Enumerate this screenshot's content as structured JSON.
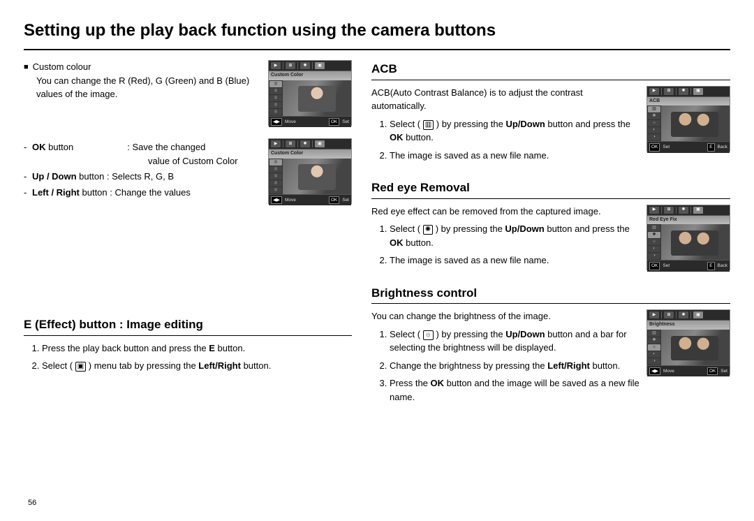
{
  "page": {
    "title": "Setting up the play back function using the camera buttons",
    "number": "56"
  },
  "custom_colour": {
    "heading": "Custom colour",
    "desc": "You can change the R (Red), G (Green) and B (Blue) values of the image.",
    "defs": {
      "ok": {
        "label": "OK",
        "suffix": " button",
        "value_line1": ": Save the changed",
        "value_line2": "value of Custom Color"
      },
      "updown": {
        "label": "Up / Down",
        "suffix": " button  : Selects R, G, B"
      },
      "leftright": {
        "label": "Left / Right",
        "suffix": " button : Change the values"
      }
    },
    "screenshot": {
      "label": "Custom Color",
      "bottom_left_btn": "◀▶",
      "bottom_left_text": "Move",
      "bottom_right_btn": "OK",
      "bottom_right_text": "Set"
    }
  },
  "effect": {
    "heading": "E (Effect) button : Image editing",
    "step1_a": "Press the play back button and press the ",
    "step1_bold": "E",
    "step1_b": " button.",
    "step2_a": "Select ( ",
    "step2_glyph": "▣",
    "step2_b": " ) menu tab by pressing the ",
    "step2_bold": "Left/Right",
    "step2_c": " button."
  },
  "acb": {
    "heading": "ACB",
    "desc": "ACB(Auto Contrast Balance) is to adjust the contrast automatically.",
    "step1_a": "Select ( ",
    "step1_glyph": "▥",
    "step1_b": " ) by pressing the ",
    "step1_bold1": "Up/Down",
    "step1_c": " button and press the ",
    "step1_bold2": "OK",
    "step1_d": " button.",
    "step2": "The image is saved as a new file name.",
    "screenshot": {
      "label": "ACB",
      "bottom_left_btn": "OK",
      "bottom_left_text": "Set",
      "bottom_right_btn": "E",
      "bottom_right_text": "Back"
    }
  },
  "redeye": {
    "heading": "Red eye Removal",
    "desc": "Red eye effect can be removed from the captured image.",
    "step1_a": "Select ( ",
    "step1_glyph": "✺",
    "step1_b": " ) by pressing the ",
    "step1_bold1": "Up/Down",
    "step1_c": " button and press the ",
    "step1_bold2": "OK",
    "step1_d": " button.",
    "step2": "The image is saved as a new file name.",
    "screenshot": {
      "label": "Red Eye Fix",
      "bottom_left_btn": "OK",
      "bottom_left_text": "Set",
      "bottom_right_btn": "E",
      "bottom_right_text": "Back"
    }
  },
  "brightness": {
    "heading": "Brightness control",
    "desc": "You can change the brightness of the image.",
    "step1_a": "Select ( ",
    "step1_b": " ) by pressing the ",
    "step1_bold1": "Up/Down",
    "step1_c": " button and a bar for selecting the brightness will be displayed.",
    "step2_a": "Change the brightness by pressing the ",
    "step2_bold": "Left/Right",
    "step2_b": "  button.",
    "step3_a": "Press the ",
    "step3_bold": "OK",
    "step3_b": " button and the image will be saved as a new file name.",
    "screenshot": {
      "label": "Brightness",
      "bottom_left_btn": "◀▶",
      "bottom_left_text": "Move",
      "bottom_right_btn": "OK",
      "bottom_right_text": "Set"
    }
  }
}
